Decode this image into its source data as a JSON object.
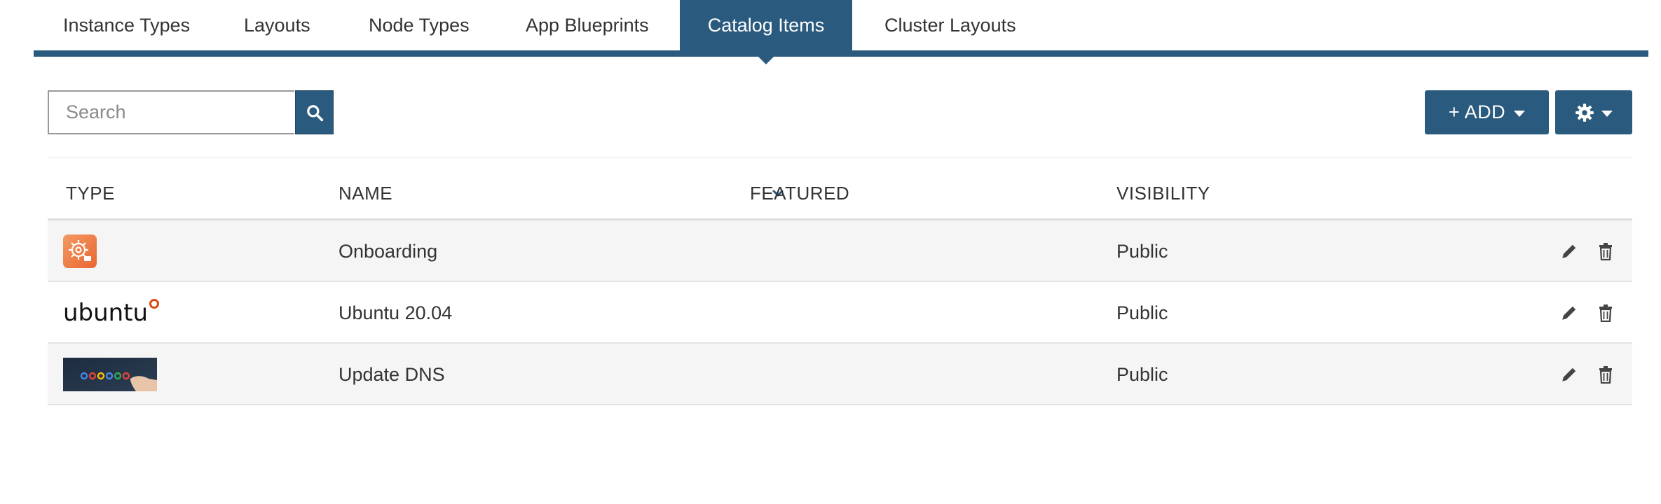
{
  "tabs": [
    {
      "label": "Instance Types",
      "active": false
    },
    {
      "label": "Layouts",
      "active": false
    },
    {
      "label": "Node Types",
      "active": false
    },
    {
      "label": "App Blueprints",
      "active": false
    },
    {
      "label": "Catalog Items",
      "active": true
    },
    {
      "label": "Cluster Layouts",
      "active": false
    }
  ],
  "toolbar": {
    "search_placeholder": "Search",
    "search_value": "",
    "add_label": "+ ADD",
    "settings_icon": "gear-icon"
  },
  "table": {
    "columns": [
      "TYPE",
      "NAME",
      "FEATURED",
      "VISIBILITY"
    ],
    "sorted_column": "FEATURED",
    "sort_direction": "desc",
    "rows": [
      {
        "type_icon": "onboarding-gear-icon",
        "name": "Onboarding",
        "featured": "",
        "visibility": "Public"
      },
      {
        "type_icon": "ubuntu-logo",
        "type_text": "ubuntu",
        "name": "Ubuntu 20.04",
        "featured": "",
        "visibility": "Public"
      },
      {
        "type_icon": "dns-image",
        "name": "Update DNS",
        "featured": "",
        "visibility": "Public"
      }
    ]
  },
  "colors": {
    "primary": "#2a5a7e",
    "onboarding_icon": "#ef7c45",
    "ubuntu_accent": "#dd4814"
  }
}
